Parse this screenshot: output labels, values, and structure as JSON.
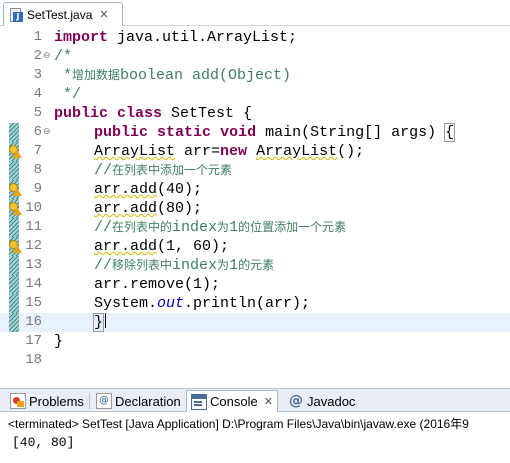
{
  "editor": {
    "tab": {
      "title": "SetTest.java",
      "close": "✕",
      "icon": "java-file-icon"
    },
    "lines": [
      {
        "num": "1",
        "fold": "",
        "marker": "none",
        "tokens": [
          {
            "t": "import",
            "c": "kw"
          },
          {
            "t": " java.util.ArrayList;",
            "c": ""
          }
        ]
      },
      {
        "num": "2",
        "fold": "⊖",
        "marker": "none",
        "tokens": [
          {
            "t": "/*",
            "c": "cm"
          }
        ]
      },
      {
        "num": "3",
        "fold": "",
        "marker": "none",
        "tokens": [
          {
            "t": " *",
            "c": "cm"
          },
          {
            "t": "增加数据",
            "c": "cm cmtxt"
          },
          {
            "t": "boolean add(Object)",
            "c": "cm"
          }
        ]
      },
      {
        "num": "4",
        "fold": "",
        "marker": "none",
        "tokens": [
          {
            "t": " */",
            "c": "cm"
          }
        ]
      },
      {
        "num": "5",
        "fold": "",
        "marker": "none",
        "tokens": [
          {
            "t": "public",
            "c": "kw"
          },
          {
            "t": " ",
            "c": ""
          },
          {
            "t": "class",
            "c": "kw"
          },
          {
            "t": " SetTest {",
            "c": ""
          }
        ]
      },
      {
        "num": "6",
        "fold": "⊖",
        "marker": "change",
        "indent": true,
        "tokens": [
          {
            "t": "public",
            "c": "kw"
          },
          {
            "t": " ",
            "c": ""
          },
          {
            "t": "static",
            "c": "kw"
          },
          {
            "t": " ",
            "c": ""
          },
          {
            "t": "void",
            "c": "kw"
          },
          {
            "t": " main(String[] args) ",
            "c": ""
          },
          {
            "t": "{",
            "c": "box"
          }
        ]
      },
      {
        "num": "7",
        "fold": "",
        "marker": "warning",
        "indent": true,
        "tokens": [
          {
            "t": "ArrayList",
            "c": "squig"
          },
          {
            "t": " arr=",
            "c": ""
          },
          {
            "t": "new",
            "c": "kw"
          },
          {
            "t": " ",
            "c": ""
          },
          {
            "t": "ArrayList",
            "c": "squig"
          },
          {
            "t": "();",
            "c": ""
          }
        ]
      },
      {
        "num": "8",
        "fold": "",
        "marker": "change",
        "indent": true,
        "tokens": [
          {
            "t": "//",
            "c": "cm"
          },
          {
            "t": "在列表中添加一个元素",
            "c": "cm cmtxt"
          }
        ]
      },
      {
        "num": "9",
        "fold": "",
        "marker": "warning",
        "indent": true,
        "tokens": [
          {
            "t": "arr.add",
            "c": "squig"
          },
          {
            "t": "(40);",
            "c": ""
          }
        ]
      },
      {
        "num": "10",
        "fold": "",
        "marker": "warning",
        "indent": true,
        "tokens": [
          {
            "t": "arr.add",
            "c": "squig"
          },
          {
            "t": "(80);",
            "c": ""
          }
        ]
      },
      {
        "num": "11",
        "fold": "",
        "marker": "change",
        "indent": true,
        "tokens": [
          {
            "t": "//",
            "c": "cm"
          },
          {
            "t": "在列表中的",
            "c": "cm cmtxt"
          },
          {
            "t": "index",
            "c": "cm"
          },
          {
            "t": "为",
            "c": "cm cmtxt"
          },
          {
            "t": "1",
            "c": "cm"
          },
          {
            "t": "的位置添加一个元素",
            "c": "cm cmtxt"
          }
        ]
      },
      {
        "num": "12",
        "fold": "",
        "marker": "warning",
        "indent": true,
        "tokens": [
          {
            "t": "arr.add",
            "c": "squig"
          },
          {
            "t": "(1, 60);",
            "c": ""
          }
        ]
      },
      {
        "num": "13",
        "fold": "",
        "marker": "change",
        "indent": true,
        "tokens": [
          {
            "t": "//",
            "c": "cm"
          },
          {
            "t": "移除列表中",
            "c": "cm cmtxt"
          },
          {
            "t": "index",
            "c": "cm"
          },
          {
            "t": "为",
            "c": "cm cmtxt"
          },
          {
            "t": "1",
            "c": "cm"
          },
          {
            "t": "的元素",
            "c": "cm cmtxt"
          }
        ]
      },
      {
        "num": "14",
        "fold": "",
        "marker": "change",
        "indent": true,
        "tokens": [
          {
            "t": "arr.remove(1);",
            "c": ""
          }
        ]
      },
      {
        "num": "15",
        "fold": "",
        "marker": "change",
        "indent": true,
        "tokens": [
          {
            "t": "System.",
            "c": ""
          },
          {
            "t": "out",
            "c": "static"
          },
          {
            "t": ".println(arr);",
            "c": ""
          }
        ]
      },
      {
        "num": "16",
        "fold": "",
        "marker": "change",
        "indent": true,
        "current": true,
        "caret": true,
        "tokens": [
          {
            "t": "}",
            "c": "box"
          }
        ]
      },
      {
        "num": "17",
        "fold": "",
        "marker": "none",
        "tokens": [
          {
            "t": "}",
            "c": ""
          }
        ]
      },
      {
        "num": "18",
        "fold": "",
        "marker": "none",
        "tokens": []
      }
    ]
  },
  "panel": {
    "tabs": [
      {
        "label": "Problems",
        "icon": "problems-icon",
        "active": false
      },
      {
        "label": "Declaration",
        "icon": "declaration-icon",
        "active": false
      },
      {
        "label": "Console",
        "icon": "console-icon",
        "active": true,
        "close": "✕"
      },
      {
        "label": "Javadoc",
        "icon": "javadoc-icon",
        "active": false,
        "glyph": "@"
      }
    ],
    "console_header": "<terminated> SetTest [Java Application] D:\\Program Files\\Java\\bin\\javaw.exe (2016年9",
    "console_output": "[40, 80]"
  },
  "colors": {
    "keyword": "#7f0055",
    "comment": "#3f7f5f",
    "static_field": "#0000c0",
    "current_line": "#e8f2fe",
    "warning_underline": "#e0b400",
    "change_bar": "#3f8c8c"
  }
}
